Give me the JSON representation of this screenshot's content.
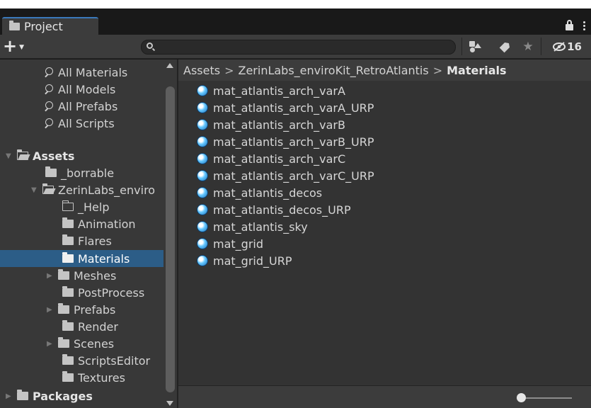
{
  "window": {
    "tab_title": "Project"
  },
  "toolbar": {
    "search_value": "",
    "search_placeholder": "",
    "hidden_packages_count": "16"
  },
  "sidebar": {
    "favorites": [
      {
        "label": "All Materials"
      },
      {
        "label": "All Models"
      },
      {
        "label": "All Prefabs"
      },
      {
        "label": "All Scripts"
      }
    ],
    "assets_label": "Assets",
    "borrable_label": "_borrable",
    "zerin_label": "ZerinLabs_enviro",
    "children": [
      {
        "label": "_Help"
      },
      {
        "label": "Animation"
      },
      {
        "label": "Flares"
      },
      {
        "label": "Materials"
      },
      {
        "label": "Meshes"
      },
      {
        "label": "PostProcess"
      },
      {
        "label": "Prefabs"
      },
      {
        "label": "Render"
      },
      {
        "label": "Scenes"
      },
      {
        "label": "ScriptsEditor"
      },
      {
        "label": "Textures"
      }
    ],
    "packages_label": "Packages"
  },
  "breadcrumb": {
    "root": "Assets",
    "sep": ">",
    "mid": "ZerinLabs_enviroKit_RetroAtlantis",
    "current": "Materials"
  },
  "assets": [
    {
      "name": "mat_atlantis_arch_varA"
    },
    {
      "name": "mat_atlantis_arch_varA_URP"
    },
    {
      "name": "mat_atlantis_arch_varB"
    },
    {
      "name": "mat_atlantis_arch_varB_URP"
    },
    {
      "name": "mat_atlantis_arch_varC"
    },
    {
      "name": "mat_atlantis_arch_varC_URP"
    },
    {
      "name": "mat_atlantis_decos"
    },
    {
      "name": "mat_atlantis_decos_URP"
    },
    {
      "name": "mat_atlantis_sky"
    },
    {
      "name": "mat_grid"
    },
    {
      "name": "mat_grid_URP"
    }
  ],
  "zoom_slider": {
    "value": 0.0
  },
  "colors": {
    "selected_row": "#2c5d87",
    "tab_accent": "#3a79bb",
    "material_icon": "#63c7ff"
  }
}
